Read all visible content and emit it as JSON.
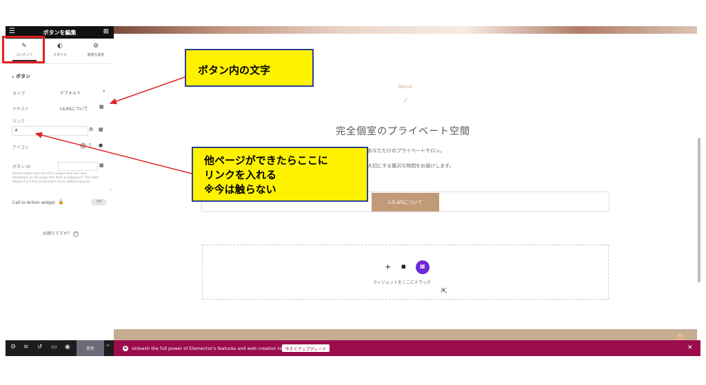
{
  "panel": {
    "title": "ボタンを編集",
    "tabs": [
      {
        "label": "コンテンツ",
        "icon": "pencil-icon"
      },
      {
        "label": "スタイル",
        "icon": "contrast-icon"
      },
      {
        "label": "高度な設定",
        "icon": "gear-icon"
      }
    ],
    "section_title": "ボタン",
    "type_label": "タイプ",
    "type_value": "デフォルト",
    "text_label": "テキスト",
    "text_value": "LILASについて",
    "link_label": "リンク",
    "link_value": "#",
    "icon_label": "アイコン",
    "button_id_label": "ボタン ID",
    "button_id_help": "Please make sure the ID is unique and not used elsewhere on the page this form is displayed. This field allows A-z 0-9 & underscore chars without spaces.",
    "cta_label": "Call to Action widget",
    "cta_toggle": "Off",
    "help_text": "お困りですか？"
  },
  "canvas": {
    "about_label": "About",
    "heading": "完全個室のプライベート空間",
    "para1": "幾ねる、あなただけのプライベートサロン。",
    "para2": "、自分を大切にする贅沢な時間をお届けします。",
    "button_label": "LILASについて",
    "drop_hint": "ウィジェットをここにドラッグ"
  },
  "footer": {
    "update_label": "更新",
    "promo_text": "Unleash the full power of Elementor's features and web creation tools.",
    "upgrade_label": "今すぐアップグレード",
    "close_symbol": "✕"
  },
  "callouts": {
    "top": "ボタン内の文字",
    "bottom_line1": "他ページができたらここに",
    "bottom_line2": "リンクを入れる",
    "bottom_line3": "※今は触らない"
  },
  "colors": {
    "accent_button": "#c19a78",
    "footer_bar": "#9b0c4c",
    "callout_fill": "#fff200",
    "annotation_red": "#e02020",
    "widget_purple": "#6d28d9"
  }
}
